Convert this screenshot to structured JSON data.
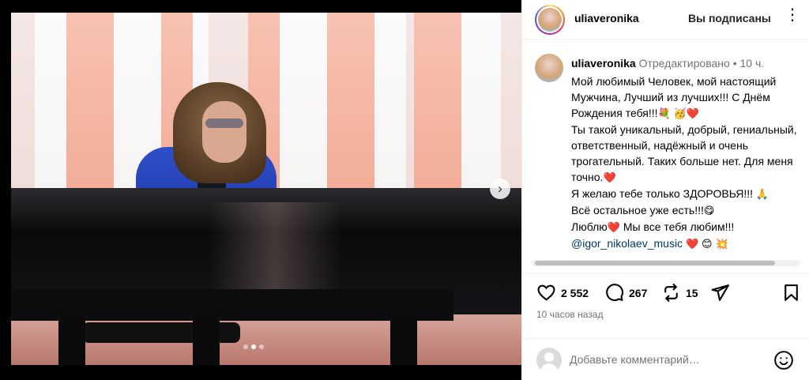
{
  "post": {
    "author": "uliaveronika",
    "follow_status": "Вы подписаны",
    "more_icon": "more-horizontal-icon"
  },
  "media": {
    "next_icon": "chevron-right-icon",
    "slide_count": 3,
    "active_slide": 2
  },
  "caption": {
    "author": "uliaveronika",
    "edited": "Отредактировано",
    "separator": "•",
    "time_ago": "10 ч.",
    "lines": [
      "Мой любимый Человек, мой настоящий Мужчина, Лучший из лучших!!! С Днём Рождения тебя!!!",
      "Ты такой уникальный, добрый, гениальный, ответственный, надёжный и очень трогательный. Таких больше нет. Для меня точно.",
      "Я желаю тебе только ЗДОРОВЬЯ!!!",
      "Всё остальное уже есть!!!",
      "Люблю",
      "Мы все тебя любим!!!",
      "@igor_nikolaev_music"
    ],
    "emoji": {
      "bouquet": "💐",
      "face": "🥳",
      "heart": "❤️",
      "pray": "🙏",
      "yum": "😋",
      "blush": "😊",
      "sparkle": "💥"
    }
  },
  "actions": {
    "likes": "2 552",
    "comments": "267",
    "reposts": "15",
    "like_icon": "heart-icon",
    "comment_icon": "comment-icon",
    "repost_icon": "repost-icon",
    "share_icon": "send-icon",
    "save_icon": "bookmark-icon"
  },
  "timestamp": "10 часов назад",
  "comment": {
    "placeholder": "Добавьте комментарий…",
    "emoji_icon": "emoji-icon"
  }
}
